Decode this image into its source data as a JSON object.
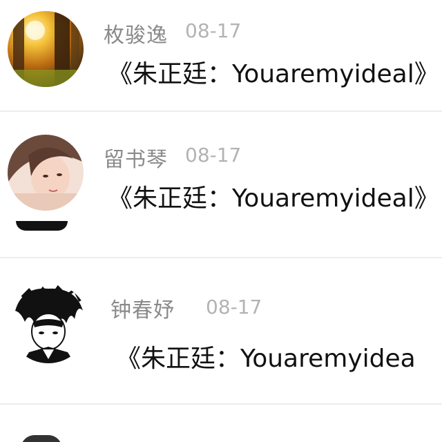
{
  "comments": [
    {
      "username": "枚骏逸",
      "date": "08-17",
      "content": "《朱正廷：Youaremyideal》",
      "avatar_icon": "sunset-forest-avatar"
    },
    {
      "username": "留书琴",
      "date": "08-17",
      "content": "《朱正廷：Youaremyideal》",
      "avatar_icon": "girl-portrait-avatar"
    },
    {
      "username": "钟春妤",
      "date": "08-17",
      "content": "《朱正廷：Youaremyidea",
      "avatar_icon": "anime-character-avatar"
    }
  ],
  "colors": {
    "username": "#8a8a8a",
    "date": "#b3b3b3",
    "content": "#111111",
    "divider": "#ededed"
  }
}
